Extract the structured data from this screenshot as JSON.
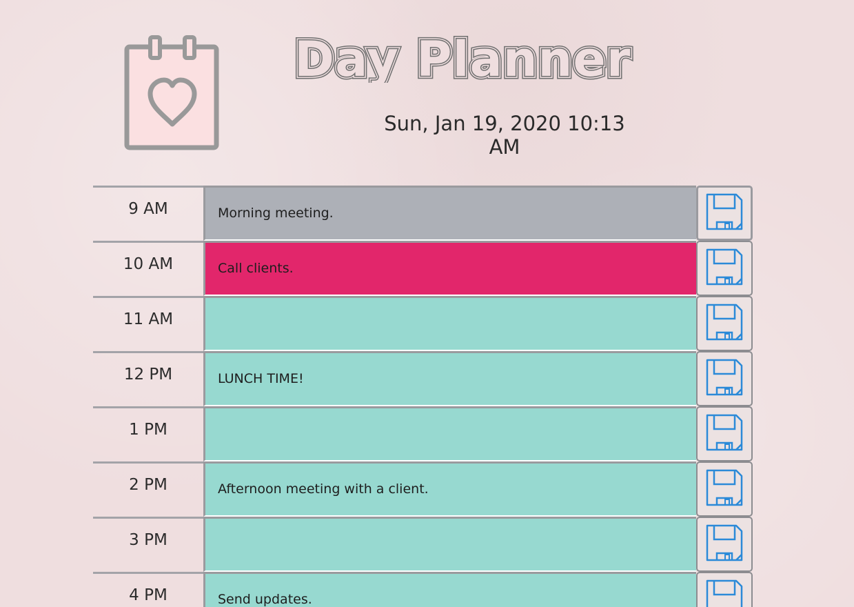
{
  "header": {
    "title": "Day Planner",
    "datetime": "Sun, Jan 19, 2020 10:13 AM",
    "logo_icon": "calendar-heart-icon"
  },
  "colors": {
    "past": "#adb0b7",
    "present": "#e2266b",
    "future": "#97d9d0",
    "save_icon": "#2b8ad8"
  },
  "rows": [
    {
      "hour": "9 AM",
      "text": "Morning meeting.",
      "state": "past"
    },
    {
      "hour": "10 AM",
      "text": "Call clients.",
      "state": "present"
    },
    {
      "hour": "11 AM",
      "text": "",
      "state": "future"
    },
    {
      "hour": "12 PM",
      "text": "LUNCH TIME!",
      "state": "future"
    },
    {
      "hour": "1 PM",
      "text": "",
      "state": "future"
    },
    {
      "hour": "2 PM",
      "text": "Afternoon meeting with a client.",
      "state": "future"
    },
    {
      "hour": "3 PM",
      "text": "",
      "state": "future"
    },
    {
      "hour": "4 PM",
      "text": "Send updates.",
      "state": "future"
    }
  ],
  "save_icon_name": "floppy-disk-icon"
}
